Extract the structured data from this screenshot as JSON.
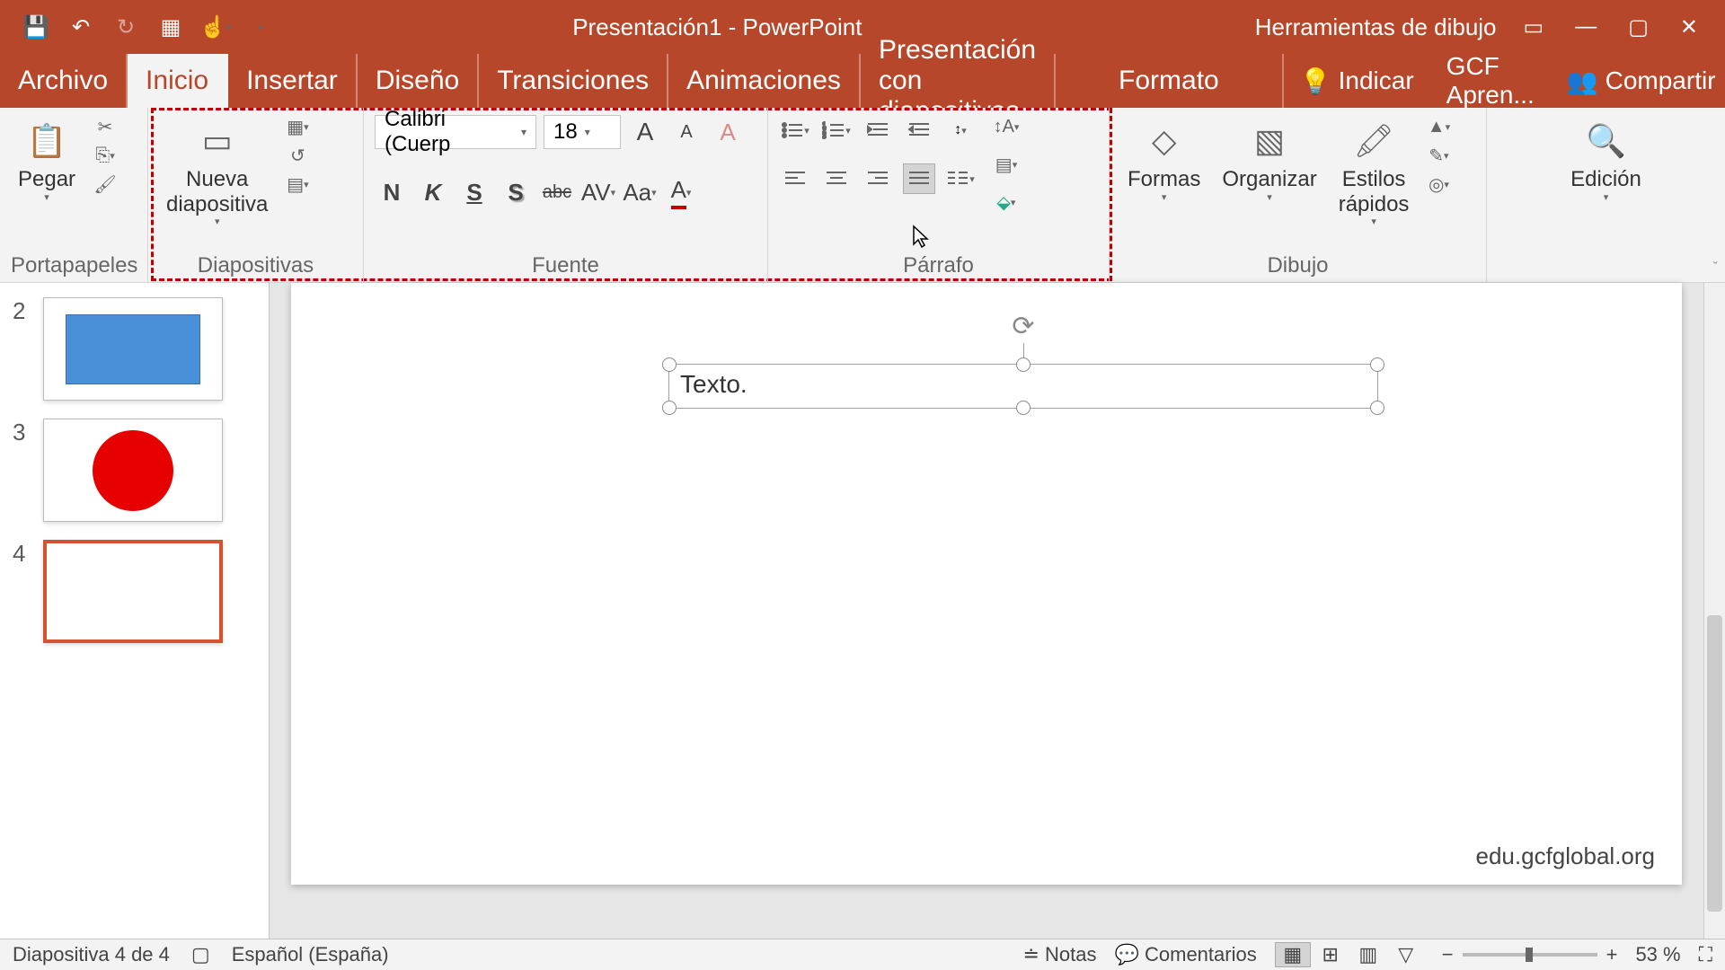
{
  "app": {
    "title": "Presentación1 - PowerPoint",
    "context_title": "Herramientas de dibujo"
  },
  "tabs": {
    "archivo": "Archivo",
    "inicio": "Inicio",
    "insertar": "Insertar",
    "diseno": "Diseño",
    "transiciones": "Transiciones",
    "animaciones": "Animaciones",
    "presentacion": "Presentación con diapositivas",
    "formato": "Formato",
    "indicar": "Indicar",
    "gcf": "GCF Apren...",
    "compartir": "Compartir"
  },
  "ribbon": {
    "portapapeles": {
      "label": "Portapapeles",
      "pegar": "Pegar"
    },
    "diapositivas": {
      "label": "Diapositivas",
      "nueva": "Nueva\ndiapositiva"
    },
    "fuente": {
      "label": "Fuente",
      "font_name": "Calibri (Cuerp",
      "font_size": "18",
      "bold": "N",
      "italic": "K",
      "underline": "S",
      "shadow": "S",
      "strike": "abc",
      "spacing": "AV",
      "case": "Aa",
      "color": "A"
    },
    "parrafo": {
      "label": "Párrafo"
    },
    "dibujo": {
      "label": "Dibujo",
      "formas": "Formas",
      "organizar": "Organizar",
      "estilos": "Estilos\nrápidos"
    },
    "edicion": {
      "label": "Edición"
    }
  },
  "slides": [
    {
      "num": "2",
      "shape": "rect"
    },
    {
      "num": "3",
      "shape": "circle"
    },
    {
      "num": "4",
      "shape": "empty",
      "selected": true
    }
  ],
  "editor": {
    "textbox": "Texto.",
    "watermark": "edu.gcfglobal.org"
  },
  "status": {
    "slide": "Diapositiva 4 de 4",
    "lang": "Español (España)",
    "notas": "Notas",
    "comentarios": "Comentarios",
    "zoom": "53 %"
  }
}
